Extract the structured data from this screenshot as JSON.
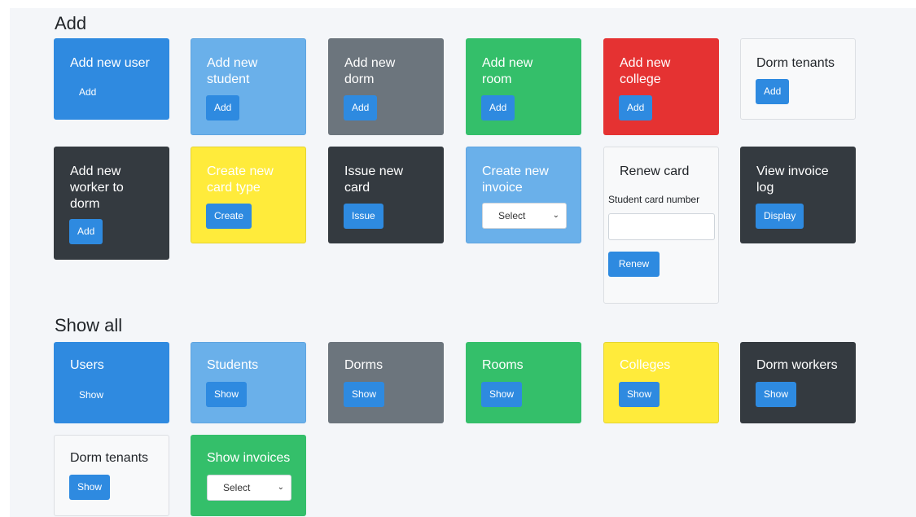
{
  "sections": {
    "add_title": "Add",
    "show_title": "Show all"
  },
  "add_cards": {
    "new_user": {
      "title": "Add new user",
      "button": "Add"
    },
    "new_student": {
      "title": "Add new\nstudent",
      "button": "Add"
    },
    "new_dorm": {
      "title": "Add new\ndorm",
      "button": "Add"
    },
    "new_room": {
      "title": "Add new\nroom",
      "button": "Add"
    },
    "new_college": {
      "title": "Add new\ncollege",
      "button": "Add"
    },
    "dorm_tenants": {
      "title": "Dorm tenants",
      "button": "Add"
    },
    "new_worker": {
      "title": "Add new\nworker to\ndorm",
      "button": "Add"
    },
    "new_card_type": {
      "title": "Create new\ncard type",
      "button": "Create"
    },
    "issue_card": {
      "title": "Issue new\ncard",
      "button": "Issue"
    },
    "new_invoice": {
      "title": "Create new\ninvoice",
      "select": "Select"
    },
    "renew_card": {
      "title": "Renew card",
      "field_label": "Student card number",
      "button": "Renew"
    },
    "invoice_log": {
      "title": "View invoice\nlog",
      "button": "Display"
    }
  },
  "show_cards": {
    "users": {
      "title": "Users",
      "button": "Show"
    },
    "students": {
      "title": "Students",
      "button": "Show"
    },
    "dorms": {
      "title": "Dorms",
      "button": "Show"
    },
    "rooms": {
      "title": "Rooms",
      "button": "Show"
    },
    "colleges": {
      "title": "Colleges",
      "button": "Show"
    },
    "dorm_workers": {
      "title": "Dorm workers",
      "button": "Show"
    },
    "dorm_tenants": {
      "title": "Dorm tenants",
      "button": "Show"
    },
    "invoices": {
      "title": "Show invoices",
      "select": "Select"
    }
  },
  "colors": {
    "primary": "#2e8ae0",
    "info": "#6ab0ea",
    "secondary": "#6c757d",
    "success": "#34bf6a",
    "danger": "#e53232",
    "light": "#f8f9fa",
    "dark": "#343a40",
    "warning": "#ffeb3b"
  }
}
